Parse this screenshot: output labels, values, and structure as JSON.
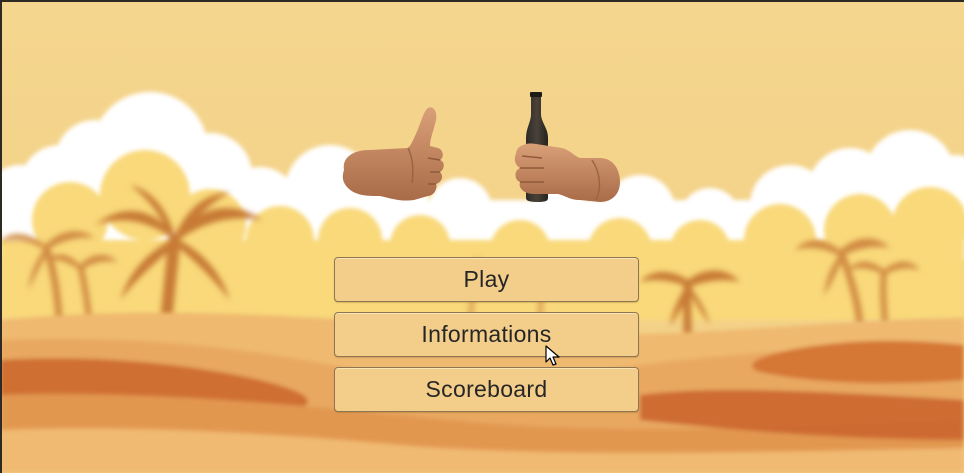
{
  "menu": {
    "play_label": "Play",
    "informations_label": "Informations",
    "scoreboard_label": "Scoreboard"
  },
  "icons": {
    "left_hand": "thumbs-up-hand-icon",
    "right_hand": "hand-holding-bottle-icon",
    "cursor": "mouse-pointer-icon"
  },
  "colors": {
    "sky": "#f4d489",
    "cloud_white": "#ffffff",
    "cloud_yellow": "#f9d97a",
    "dune_light": "#e8a860",
    "dune_dark": "#c9622a",
    "palm": "#c77a35",
    "button_fill": "#f3cd8a",
    "button_border": "#8d7650",
    "button_text": "#262626"
  }
}
